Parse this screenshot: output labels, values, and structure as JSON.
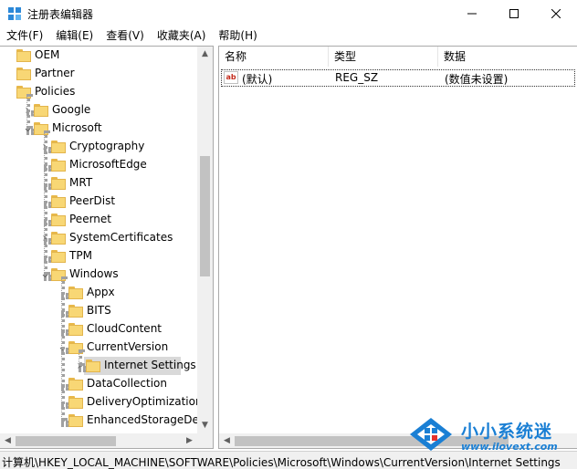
{
  "window": {
    "title": "注册表编辑器"
  },
  "menu": [
    "文件(F)",
    "编辑(E)",
    "查看(V)",
    "收藏夹(A)",
    "帮助(H)"
  ],
  "tree": [
    {
      "label": "OEM",
      "level": 0,
      "expander": "none"
    },
    {
      "label": "Partner",
      "level": 0,
      "expander": "none"
    },
    {
      "label": "Policies",
      "level": 0,
      "expander": "none"
    },
    {
      "label": "Google",
      "level": 1,
      "expander": "collapsed"
    },
    {
      "label": "Microsoft",
      "level": 1,
      "expander": "expanded"
    },
    {
      "label": "Cryptography",
      "level": 2,
      "expander": "collapsed"
    },
    {
      "label": "MicrosoftEdge",
      "level": 2,
      "expander": "none"
    },
    {
      "label": "MRT",
      "level": 2,
      "expander": "none"
    },
    {
      "label": "PeerDist",
      "level": 2,
      "expander": "none"
    },
    {
      "label": "Peernet",
      "level": 2,
      "expander": "none"
    },
    {
      "label": "SystemCertificates",
      "level": 2,
      "expander": "collapsed"
    },
    {
      "label": "TPM",
      "level": 2,
      "expander": "none"
    },
    {
      "label": "Windows",
      "level": 2,
      "expander": "expanded"
    },
    {
      "label": "Appx",
      "level": 3,
      "expander": "none"
    },
    {
      "label": "BITS",
      "level": 3,
      "expander": "none"
    },
    {
      "label": "CloudContent",
      "level": 3,
      "expander": "none"
    },
    {
      "label": "CurrentVersion",
      "level": 3,
      "expander": "expanded"
    },
    {
      "label": "Internet Settings",
      "level": 4,
      "expander": "collapsed",
      "selected": true
    },
    {
      "label": "DataCollection",
      "level": 3,
      "expander": "none"
    },
    {
      "label": "DeliveryOptimization",
      "level": 3,
      "expander": "none"
    },
    {
      "label": "EnhancedStorageDevic",
      "level": 3,
      "expander": "none"
    }
  ],
  "list": {
    "columns": [
      "名称",
      "类型",
      "数据"
    ],
    "rows": [
      {
        "name": "(默认)",
        "type": "REG_SZ",
        "data": "(数值未设置)",
        "icon": "string-value-icon"
      }
    ]
  },
  "watermark": {
    "title": "小小系统迷",
    "url": "www.ilovext.com"
  },
  "status": {
    "path": "计算机\\HKEY_LOCAL_MACHINE\\SOFTWARE\\Policies\\Microsoft\\Windows\\CurrentVersion\\Internet Settings"
  },
  "colors": {
    "folder": "#f8d775",
    "folder_border": "#e3b54c",
    "selection": "#d9d9d9",
    "watermark": "#1a7fd4"
  }
}
